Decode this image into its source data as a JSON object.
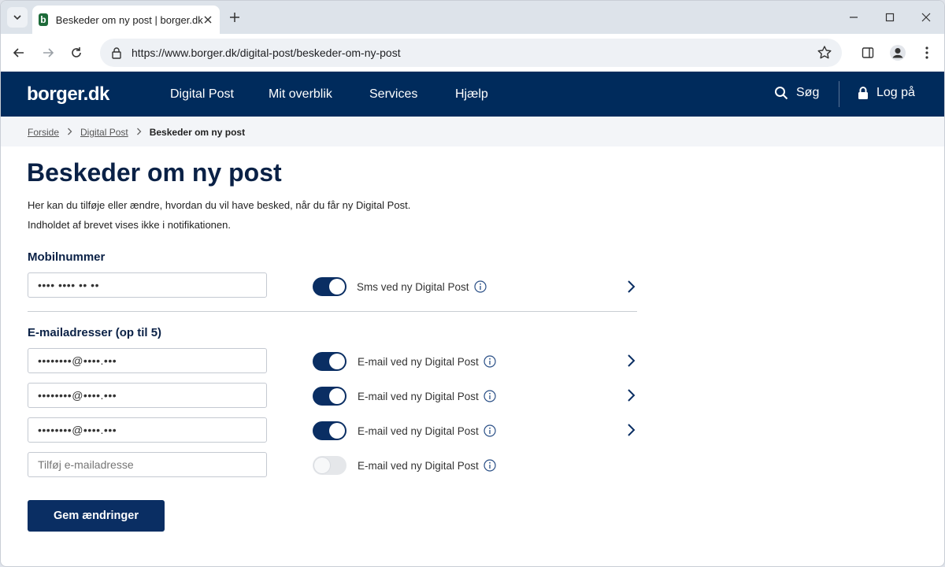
{
  "browser": {
    "tab_title": "Beskeder om ny post | borger.dk",
    "favicon_letter": "b",
    "url": "https://www.borger.dk/digital-post/beskeder-om-ny-post",
    "icons": [
      "chevron-down-icon",
      "close-icon",
      "plus-icon",
      "minimize-icon",
      "maximize-icon",
      "close-icon",
      "back-icon",
      "forward-icon",
      "reload-icon",
      "lock-icon",
      "star-icon",
      "sidepanel-icon",
      "profile-icon",
      "more-icon"
    ]
  },
  "site": {
    "logo": "borger.dk",
    "nav": [
      "Digital Post",
      "Mit overblik",
      "Services",
      "Hjælp"
    ],
    "search_label": "Søg",
    "login_label": "Log på",
    "header_bg": "#002b5c"
  },
  "breadcrumb": {
    "items": [
      "Forside",
      "Digital Post"
    ],
    "current": "Beskeder om ny post"
  },
  "page": {
    "title": "Beskeder om ny post",
    "intro_1": "Her kan du tilføje eller ændre, hvordan du vil have besked, når du får ny Digital Post.",
    "intro_2": "Indholdet af brevet vises ikke i notifikationen."
  },
  "mobile": {
    "label": "Mobilnummer",
    "value": "•••• •••• •• ••",
    "toggle_label": "Sms ved ny Digital Post",
    "toggle_on": true
  },
  "email": {
    "label": "E-mailadresser (op til 5)",
    "rows": [
      {
        "value": "••••••••@••••.•••",
        "toggle_label": "E-mail ved ny Digital Post",
        "toggle_on": true
      },
      {
        "value": "••••••••@••••.•••",
        "toggle_label": "E-mail ved ny Digital Post",
        "toggle_on": true
      },
      {
        "value": "••••••••@••••.•••",
        "toggle_label": "E-mail ved ny Digital Post",
        "toggle_on": true
      }
    ],
    "new_placeholder": "Tilføj e-mailadresse",
    "new_toggle_label": "E-mail ved ny Digital Post",
    "new_toggle_on": false
  },
  "actions": {
    "save_label": "Gem ændringer",
    "accent": "#0a2e63"
  }
}
